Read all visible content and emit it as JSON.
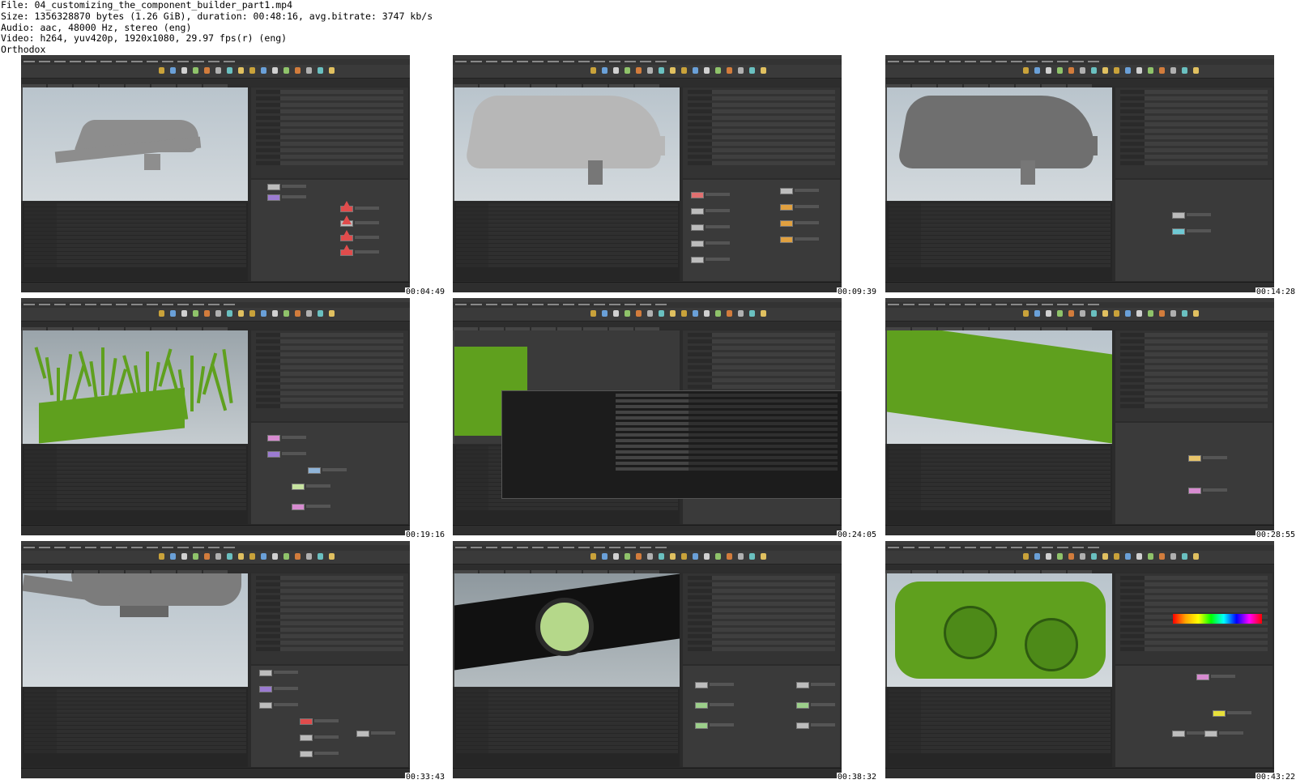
{
  "header": {
    "file_line": "File: 04_customizing_the_component_builder_part1.mp4",
    "size_line": "Size: 1356328870 bytes (1.26 GiB), duration: 00:48:16, avg.bitrate: 3747 kb/s",
    "audio_line": "Audio: aac, 48000 Hz, stereo (eng)",
    "video_line": "Video: h264, yuv420p, 1920x1080, 29.97 fps(r) (eng)",
    "watermark": "Orthodox"
  },
  "thumbnails": [
    {
      "timecode": "00:04:49",
      "scene": "ship-wireframe-top"
    },
    {
      "timecode": "00:09:39",
      "scene": "ship-grey-side"
    },
    {
      "timecode": "00:14:28",
      "scene": "ship-textured"
    },
    {
      "timecode": "00:19:16",
      "scene": "green-debris"
    },
    {
      "timecode": "00:24:05",
      "scene": "file-browser"
    },
    {
      "timecode": "00:28:55",
      "scene": "green-hull"
    },
    {
      "timecode": "00:33:43",
      "scene": "ship-underside"
    },
    {
      "timecode": "00:38:32",
      "scene": "engine-dark"
    },
    {
      "timecode": "00:43:22",
      "scene": "engine-green-color-picker"
    }
  ],
  "colors": {
    "background": "#ffffff",
    "houdini_panel": "#2b2b2b",
    "viewport_sky": "#c5ccd0",
    "geo_green": "#5fa01e",
    "error_red": "#e04c4c"
  }
}
